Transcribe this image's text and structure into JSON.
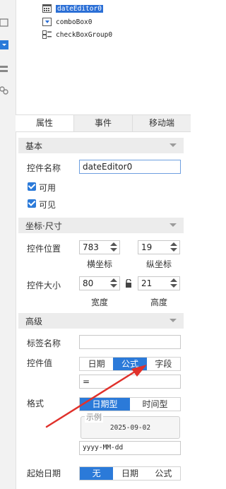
{
  "tree": {
    "items": [
      {
        "label": "dateEditor0",
        "selected": true,
        "icon": "calendar-icon"
      },
      {
        "label": "comboBox0",
        "selected": false,
        "icon": "combobox-icon"
      },
      {
        "label": "checkBoxGroup0",
        "selected": false,
        "icon": "checkbox-group-icon"
      }
    ]
  },
  "tabs": [
    {
      "label": "属性",
      "active": true
    },
    {
      "label": "事件",
      "active": false
    },
    {
      "label": "移动端",
      "active": false
    }
  ],
  "basic": {
    "title": "基本",
    "name_label": "控件名称",
    "name_value": "dateEditor0",
    "enabled_label": "可用",
    "visible_label": "可见"
  },
  "coords": {
    "title": "坐标·尺寸",
    "pos_label": "控件位置",
    "x_value": "783",
    "y_value": "19",
    "x_caption": "横坐标",
    "y_caption": "纵坐标",
    "size_label": "控件大小",
    "w_value": "80",
    "h_value": "21",
    "w_caption": "宽度",
    "h_caption": "高度"
  },
  "advanced": {
    "title": "高级",
    "tag_label": "标签名称",
    "tag_value": "",
    "value_label": "控件值",
    "value_modes": [
      "日期",
      "公式",
      "字段"
    ],
    "value_mode_selected": "公式",
    "formula_value": "=",
    "format_label": "格式",
    "format_modes": [
      "日期型",
      "时间型"
    ],
    "format_selected": "日期型",
    "example_legend": "示例",
    "example_value": "2025-09-02",
    "format_value": "yyyy-MM-dd",
    "start_label": "起始日期",
    "start_modes": [
      "无",
      "日期",
      "公式"
    ],
    "start_selected": "无"
  },
  "colors": {
    "accent": "#2b7ad9",
    "arrow": "#e0312b"
  }
}
